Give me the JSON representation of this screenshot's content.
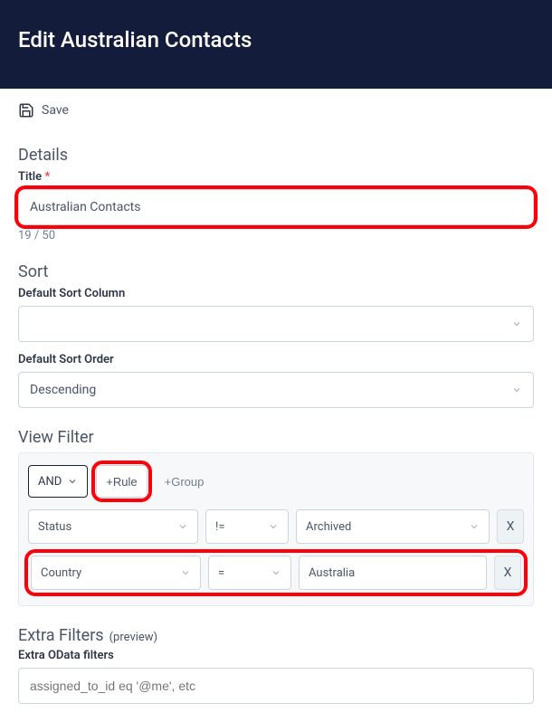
{
  "header": {
    "title": "Edit Australian Contacts"
  },
  "actions": {
    "save_label": "Save"
  },
  "details": {
    "section": "Details",
    "title_label": "Title",
    "title_value": "Australian Contacts",
    "counter": "19 / 50"
  },
  "sort": {
    "section": "Sort",
    "col_label": "Default Sort Column",
    "col_value": "",
    "order_label": "Default Sort Order",
    "order_value": "Descending"
  },
  "filter": {
    "section": "View Filter",
    "logic": "AND",
    "add_rule": "+Rule",
    "add_group": "+Group",
    "rules": [
      {
        "field": "Status",
        "op": "!=",
        "value": "Archived"
      },
      {
        "field": "Country",
        "op": "=",
        "value": "Australia"
      }
    ],
    "remove": "X"
  },
  "extra": {
    "section": "Extra Filters",
    "preview": "(preview)",
    "label": "Extra OData filters",
    "placeholder": "assigned_to_id eq '@me', etc"
  }
}
